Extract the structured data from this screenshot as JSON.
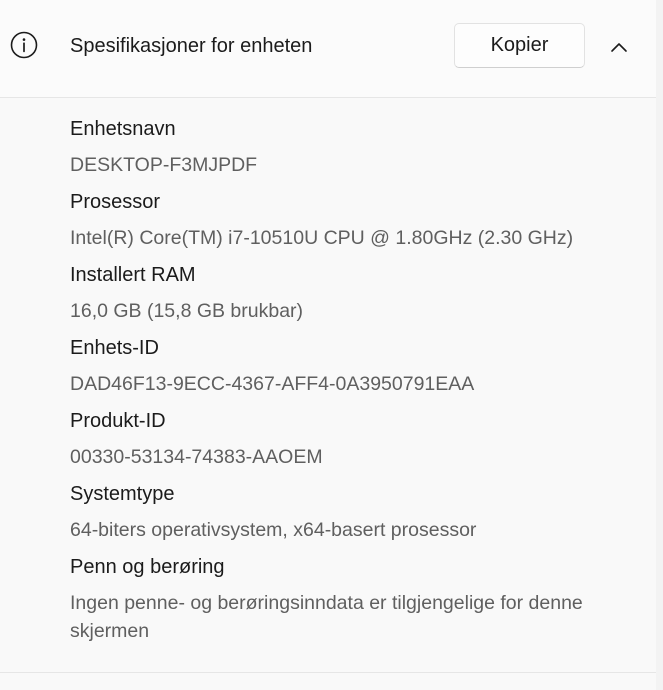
{
  "header": {
    "title": "Spesifikasjoner for enheten",
    "copy_label": "Kopier",
    "info_icon": "info-icon",
    "collapse_icon": "chevron-up-icon"
  },
  "specs": [
    {
      "label": "Enhetsnavn",
      "value": "DESKTOP-F3MJPDF"
    },
    {
      "label": "Prosessor",
      "value": "Intel(R) Core(TM) i7-10510U CPU @ 1.80GHz (2.30 GHz)"
    },
    {
      "label": "Installert RAM",
      "value": "16,0 GB (15,8 GB brukbar)"
    },
    {
      "label": "Enhets-ID",
      "value": "DAD46F13-9ECC-4367-AFF4-0A3950791EAA"
    },
    {
      "label": "Produkt-ID",
      "value": "00330-53134-74383-AAOEM"
    },
    {
      "label": "Systemtype",
      "value": "64-biters operativsystem, x64-basert prosessor"
    },
    {
      "label": "Penn og berøring",
      "value": "Ingen penne- og berøringsinndata er tilgjengelige for denne skjermen"
    }
  ]
}
